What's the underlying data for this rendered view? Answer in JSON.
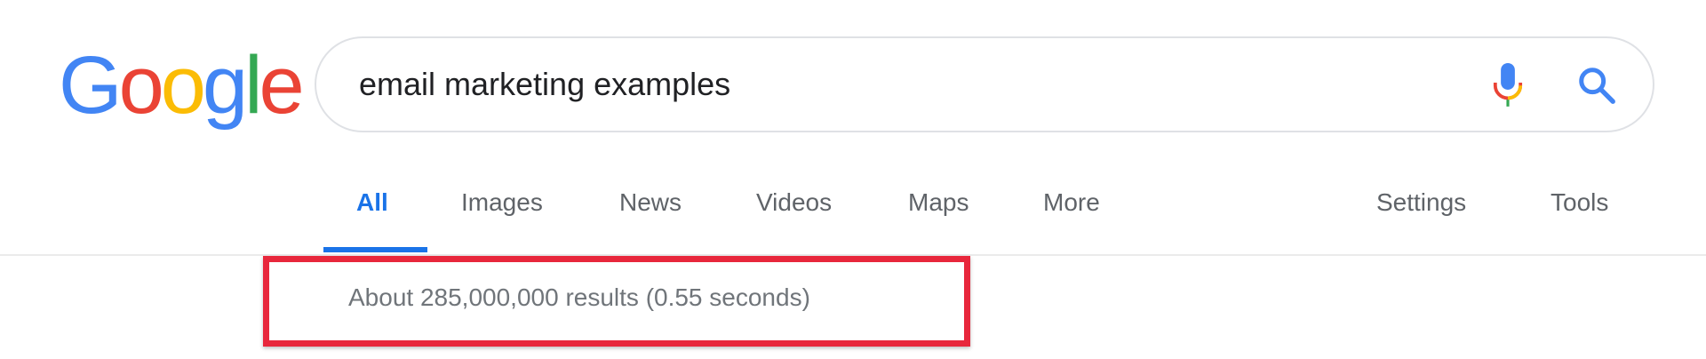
{
  "logo": {
    "letters": [
      {
        "char": "G",
        "color": "#4285F4"
      },
      {
        "char": "o",
        "color": "#EA4335"
      },
      {
        "char": "o",
        "color": "#FBBC05"
      },
      {
        "char": "g",
        "color": "#4285F4"
      },
      {
        "char": "l",
        "color": "#34A853"
      },
      {
        "char": "e",
        "color": "#EA4335"
      }
    ]
  },
  "search": {
    "query": "email marketing examples",
    "mic_icon": "mic-icon",
    "search_icon": "search-icon"
  },
  "tabs": {
    "items": [
      {
        "label": "All",
        "active": true
      },
      {
        "label": "Images",
        "active": false
      },
      {
        "label": "News",
        "active": false
      },
      {
        "label": "Videos",
        "active": false
      },
      {
        "label": "Maps",
        "active": false
      },
      {
        "label": "More",
        "active": false
      }
    ],
    "settings_label": "Settings",
    "tools_label": "Tools"
  },
  "results": {
    "stats": "About 285,000,000 results (0.55 seconds)"
  },
  "colors": {
    "accent_blue": "#1a73e8",
    "highlight_red": "#e8273c",
    "tab_gray": "#5f6368",
    "stats_gray": "#70757a"
  }
}
